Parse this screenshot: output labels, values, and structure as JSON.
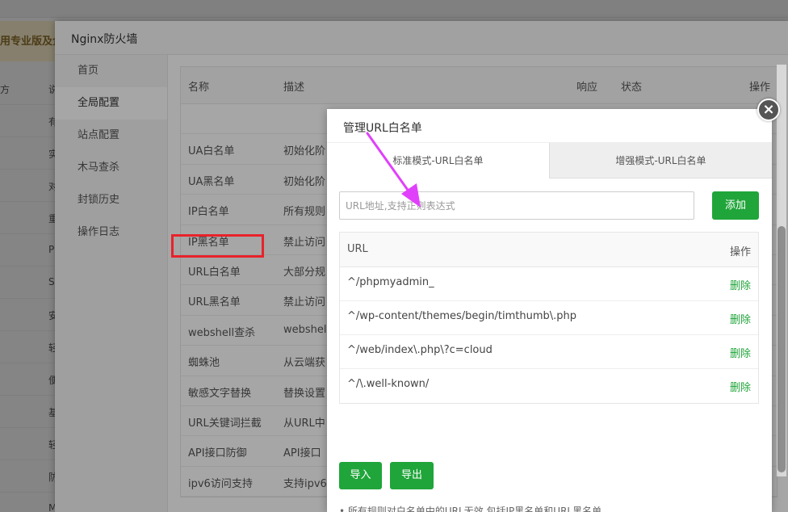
{
  "background": {
    "banner_text": "用专业版及企",
    "col0_label": "方",
    "col1_items": [
      "说",
      "有",
      "实",
      "对",
      "重",
      "PH",
      "Se",
      "安",
      "轻",
      "便",
      "基",
      "轻",
      "防",
      "M"
    ]
  },
  "firewall": {
    "title": "Nginx防火墙",
    "sidebar": [
      {
        "label": "首页",
        "active": false
      },
      {
        "label": "全局配置",
        "active": true
      },
      {
        "label": "站点配置",
        "active": false
      },
      {
        "label": "木马查杀",
        "active": false
      },
      {
        "label": "封锁历史",
        "active": false
      },
      {
        "label": "操作日志",
        "active": false
      }
    ],
    "table": {
      "headers": {
        "name": "名称",
        "desc": "描述",
        "response": "响应",
        "status": "状态",
        "action": "操作"
      },
      "rows": [
        {
          "name": "",
          "desc": ""
        },
        {
          "name": "UA白名单",
          "desc": "初始化阶"
        },
        {
          "name": "UA黑名单",
          "desc": "初始化阶"
        },
        {
          "name": "IP白名单",
          "desc": "所有规则"
        },
        {
          "name": "IP黑名单",
          "desc": "禁止访问"
        },
        {
          "name": "URL白名单",
          "desc": "大部分规"
        },
        {
          "name": "URL黑名单",
          "desc": "禁止访问"
        },
        {
          "name": "webshell查杀",
          "desc": "webshell"
        },
        {
          "name": "蜘蛛池",
          "desc": "从云端获"
        },
        {
          "name": "敏感文字替换",
          "desc": "替换设置"
        },
        {
          "name": "URL关键词拦截",
          "desc": "从URL中"
        },
        {
          "name": "API接口防御",
          "desc": "API接口"
        },
        {
          "name": "ipv6访问支持",
          "desc": "支持ipv6"
        }
      ]
    }
  },
  "dialog": {
    "title": "管理URL白名单",
    "close_symbol": "×",
    "tabs": [
      {
        "label": "标准模式-URL白名单",
        "active": true
      },
      {
        "label": "增强模式-URL白名单",
        "active": false
      }
    ],
    "input_placeholder": "URL地址,支持正则表达式",
    "add_label": "添加",
    "table_headers": {
      "url": "URL",
      "action": "操作"
    },
    "rows": [
      {
        "url": "^/phpmyadmin_",
        "action": "删除"
      },
      {
        "url": "^/wp-content/themes/begin/timthumb\\.php",
        "action": "删除"
      },
      {
        "url": "^/web/index\\.php\\?c=cloud",
        "action": "删除"
      },
      {
        "url": "^/\\.well-known/",
        "action": "删除"
      }
    ],
    "import_label": "导入",
    "export_label": "导出",
    "note": "• 所有规则对白名单中的URL无效,包括IP黑名单和URL黑名单"
  },
  "colors": {
    "accent_green": "#20a53a",
    "highlight_red": "#e8222b",
    "arrow_magenta": "#e040fb"
  }
}
